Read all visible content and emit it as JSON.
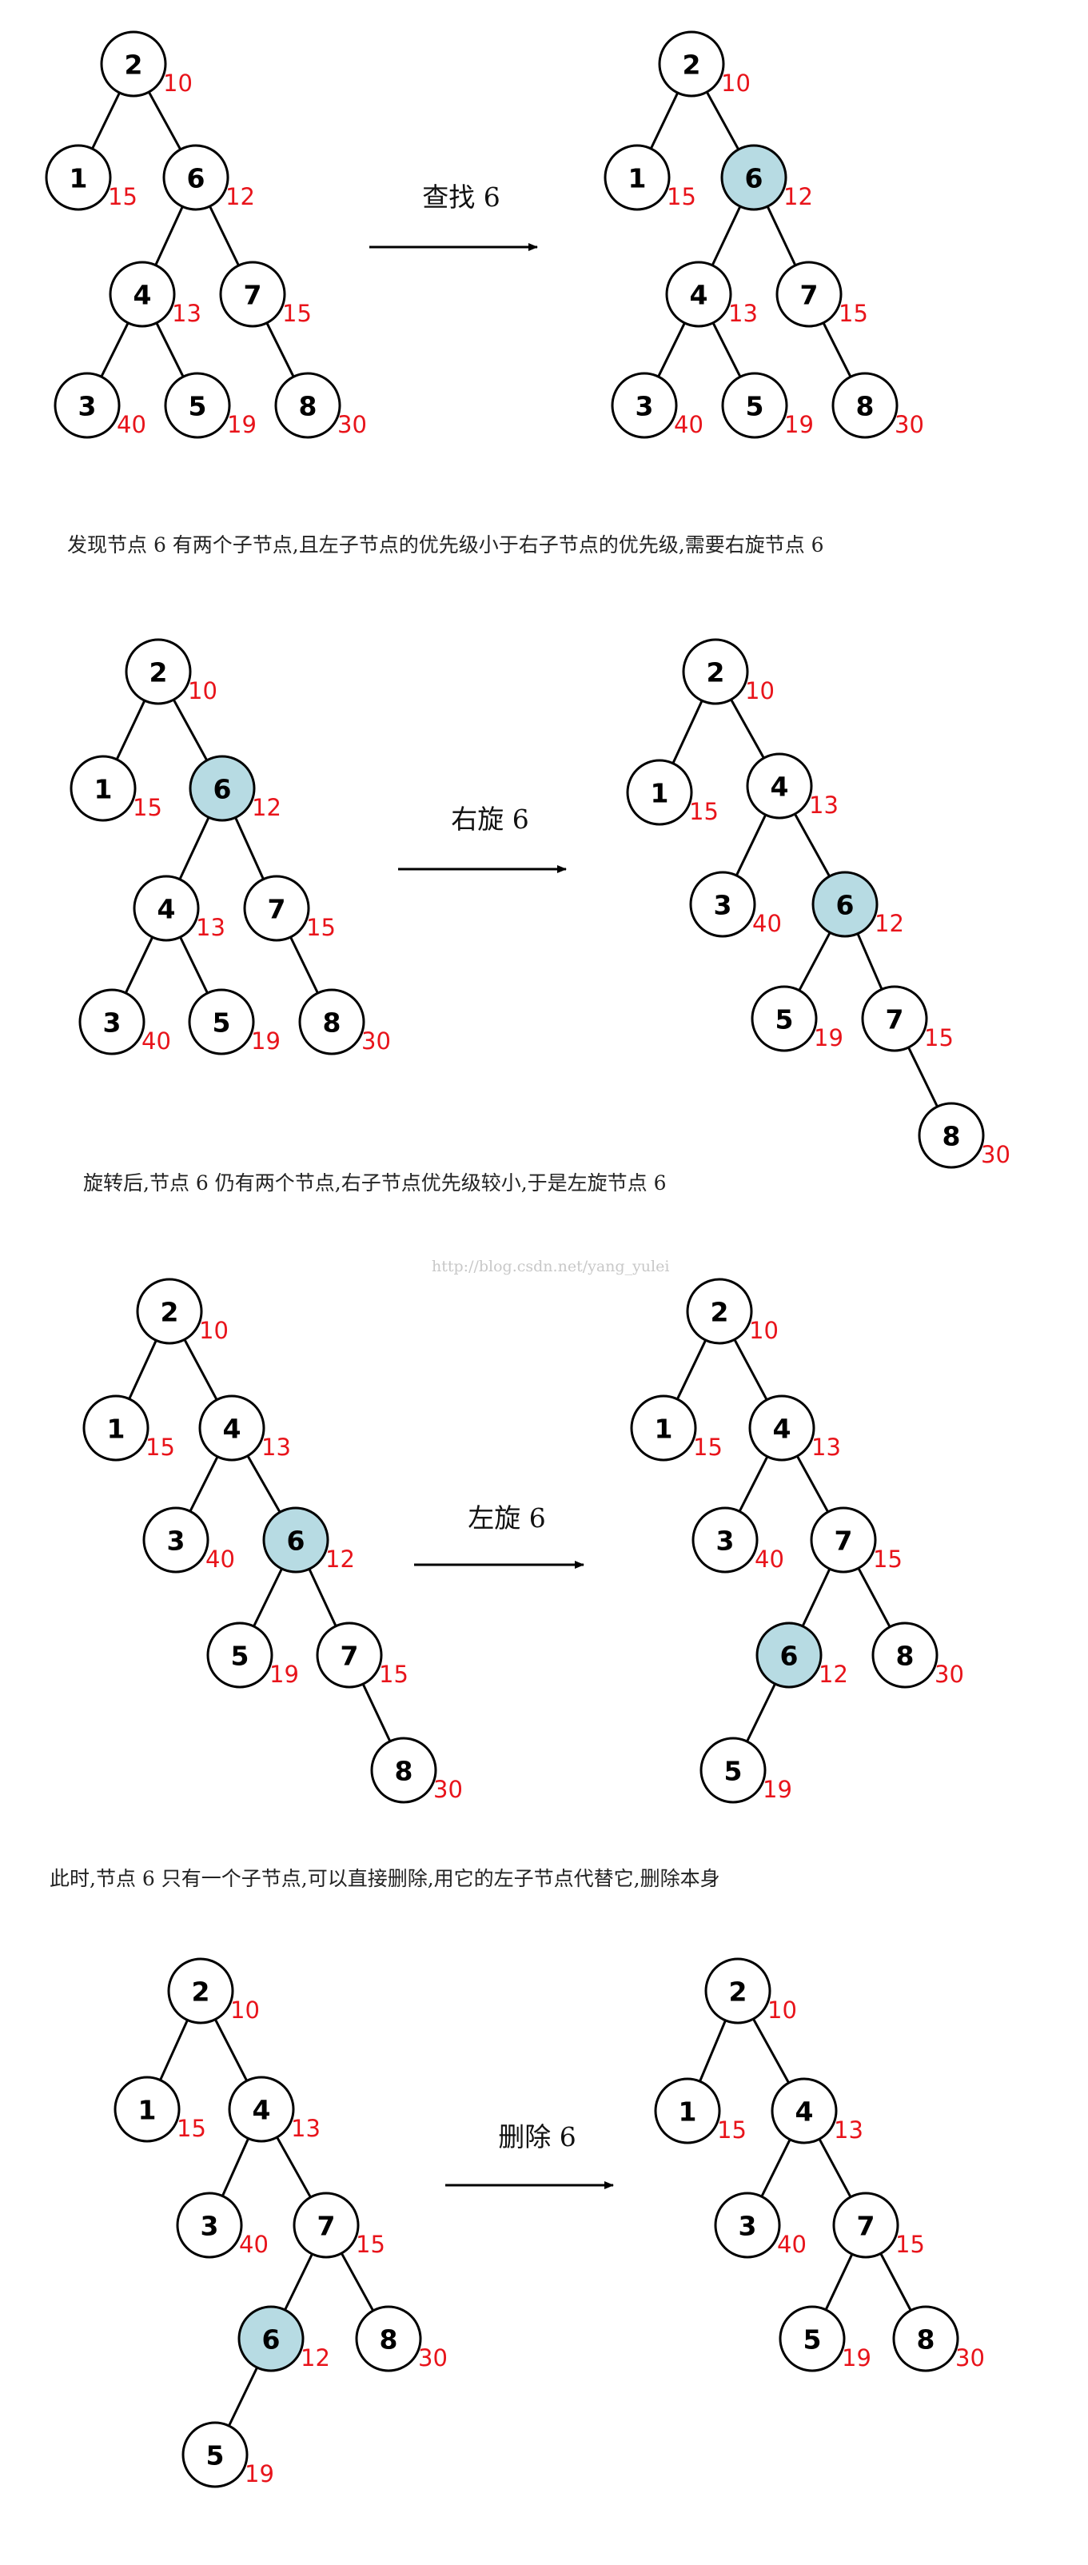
{
  "steps": [
    {
      "id": "find",
      "operation": "查找 6",
      "before": {
        "nodes": [
          {
            "key": "2",
            "pri": "10"
          },
          {
            "key": "1",
            "pri": "15"
          },
          {
            "key": "6",
            "pri": "12"
          },
          {
            "key": "4",
            "pri": "13"
          },
          {
            "key": "7",
            "pri": "15"
          },
          {
            "key": "3",
            "pri": "40"
          },
          {
            "key": "5",
            "pri": "19"
          },
          {
            "key": "8",
            "pri": "30"
          }
        ],
        "edges": [
          [
            "2",
            "1"
          ],
          [
            "2",
            "6"
          ],
          [
            "6",
            "4"
          ],
          [
            "6",
            "7"
          ],
          [
            "4",
            "3"
          ],
          [
            "4",
            "5"
          ],
          [
            "7",
            "8"
          ]
        ],
        "highlight": []
      },
      "after": {
        "nodes": [
          {
            "key": "2",
            "pri": "10"
          },
          {
            "key": "1",
            "pri": "15"
          },
          {
            "key": "6",
            "pri": "12"
          },
          {
            "key": "4",
            "pri": "13"
          },
          {
            "key": "7",
            "pri": "15"
          },
          {
            "key": "3",
            "pri": "40"
          },
          {
            "key": "5",
            "pri": "19"
          },
          {
            "key": "8",
            "pri": "30"
          }
        ],
        "edges": [
          [
            "2",
            "1"
          ],
          [
            "2",
            "6"
          ],
          [
            "6",
            "4"
          ],
          [
            "6",
            "7"
          ],
          [
            "4",
            "3"
          ],
          [
            "4",
            "5"
          ],
          [
            "7",
            "8"
          ]
        ],
        "highlight": [
          "6"
        ]
      },
      "caption": "发现节点 6 有两个子节点,且左子节点的优先级小于右子节点的优先级,需要右旋节点 6"
    },
    {
      "id": "rotate-right",
      "operation": "右旋 6",
      "before": {
        "nodes": [
          {
            "key": "2",
            "pri": "10"
          },
          {
            "key": "1",
            "pri": "15"
          },
          {
            "key": "6",
            "pri": "12"
          },
          {
            "key": "4",
            "pri": "13"
          },
          {
            "key": "7",
            "pri": "15"
          },
          {
            "key": "3",
            "pri": "40"
          },
          {
            "key": "5",
            "pri": "19"
          },
          {
            "key": "8",
            "pri": "30"
          }
        ],
        "edges": [
          [
            "2",
            "1"
          ],
          [
            "2",
            "6"
          ],
          [
            "6",
            "4"
          ],
          [
            "6",
            "7"
          ],
          [
            "4",
            "3"
          ],
          [
            "4",
            "5"
          ],
          [
            "7",
            "8"
          ]
        ],
        "highlight": [
          "6"
        ]
      },
      "after": {
        "nodes": [
          {
            "key": "2",
            "pri": "10"
          },
          {
            "key": "1",
            "pri": "15"
          },
          {
            "key": "4",
            "pri": "13"
          },
          {
            "key": "3",
            "pri": "40"
          },
          {
            "key": "6",
            "pri": "12"
          },
          {
            "key": "5",
            "pri": "19"
          },
          {
            "key": "7",
            "pri": "15"
          },
          {
            "key": "8",
            "pri": "30"
          }
        ],
        "edges": [
          [
            "2",
            "1"
          ],
          [
            "2",
            "4"
          ],
          [
            "4",
            "3"
          ],
          [
            "4",
            "6"
          ],
          [
            "6",
            "5"
          ],
          [
            "6",
            "7"
          ],
          [
            "7",
            "8"
          ]
        ],
        "highlight": [
          "6"
        ]
      },
      "caption": "旋转后,节点 6 仍有两个节点,右子节点优先级较小,于是左旋节点 6"
    },
    {
      "id": "rotate-left",
      "operation": "左旋 6",
      "before": {
        "nodes": [
          {
            "key": "2",
            "pri": "10"
          },
          {
            "key": "1",
            "pri": "15"
          },
          {
            "key": "4",
            "pri": "13"
          },
          {
            "key": "3",
            "pri": "40"
          },
          {
            "key": "6",
            "pri": "12"
          },
          {
            "key": "5",
            "pri": "19"
          },
          {
            "key": "7",
            "pri": "15"
          },
          {
            "key": "8",
            "pri": "30"
          }
        ],
        "edges": [
          [
            "2",
            "1"
          ],
          [
            "2",
            "4"
          ],
          [
            "4",
            "3"
          ],
          [
            "4",
            "6"
          ],
          [
            "6",
            "5"
          ],
          [
            "6",
            "7"
          ],
          [
            "7",
            "8"
          ]
        ],
        "highlight": [
          "6"
        ]
      },
      "after": {
        "nodes": [
          {
            "key": "2",
            "pri": "10"
          },
          {
            "key": "1",
            "pri": "15"
          },
          {
            "key": "4",
            "pri": "13"
          },
          {
            "key": "3",
            "pri": "40"
          },
          {
            "key": "7",
            "pri": "15"
          },
          {
            "key": "6",
            "pri": "12"
          },
          {
            "key": "8",
            "pri": "30"
          },
          {
            "key": "5",
            "pri": "19"
          }
        ],
        "edges": [
          [
            "2",
            "1"
          ],
          [
            "2",
            "4"
          ],
          [
            "4",
            "3"
          ],
          [
            "4",
            "7"
          ],
          [
            "7",
            "6"
          ],
          [
            "7",
            "8"
          ],
          [
            "6",
            "5"
          ]
        ],
        "highlight": [
          "6"
        ]
      },
      "caption": "此时,节点 6 只有一个子节点,可以直接删除,用它的左子节点代替它,删除本身"
    },
    {
      "id": "delete",
      "operation": "删除 6",
      "before": {
        "nodes": [
          {
            "key": "2",
            "pri": "10"
          },
          {
            "key": "1",
            "pri": "15"
          },
          {
            "key": "4",
            "pri": "13"
          },
          {
            "key": "3",
            "pri": "40"
          },
          {
            "key": "7",
            "pri": "15"
          },
          {
            "key": "6",
            "pri": "12"
          },
          {
            "key": "8",
            "pri": "30"
          },
          {
            "key": "5",
            "pri": "19"
          }
        ],
        "edges": [
          [
            "2",
            "1"
          ],
          [
            "2",
            "4"
          ],
          [
            "4",
            "3"
          ],
          [
            "4",
            "7"
          ],
          [
            "7",
            "6"
          ],
          [
            "7",
            "8"
          ],
          [
            "6",
            "5"
          ]
        ],
        "highlight": [
          "6"
        ]
      },
      "after": {
        "nodes": [
          {
            "key": "2",
            "pri": "10"
          },
          {
            "key": "1",
            "pri": "15"
          },
          {
            "key": "4",
            "pri": "13"
          },
          {
            "key": "3",
            "pri": "40"
          },
          {
            "key": "7",
            "pri": "15"
          },
          {
            "key": "5",
            "pri": "19"
          },
          {
            "key": "8",
            "pri": "30"
          }
        ],
        "edges": [
          [
            "2",
            "1"
          ],
          [
            "2",
            "4"
          ],
          [
            "4",
            "3"
          ],
          [
            "4",
            "7"
          ],
          [
            "7",
            "5"
          ],
          [
            "7",
            "8"
          ]
        ],
        "highlight": []
      },
      "caption": ""
    }
  ],
  "watermark": "http://blog.csdn.net/yang_yulei",
  "colors": {
    "highlight_fill": "#b7dbe3",
    "priority_text": "#e8141b"
  }
}
